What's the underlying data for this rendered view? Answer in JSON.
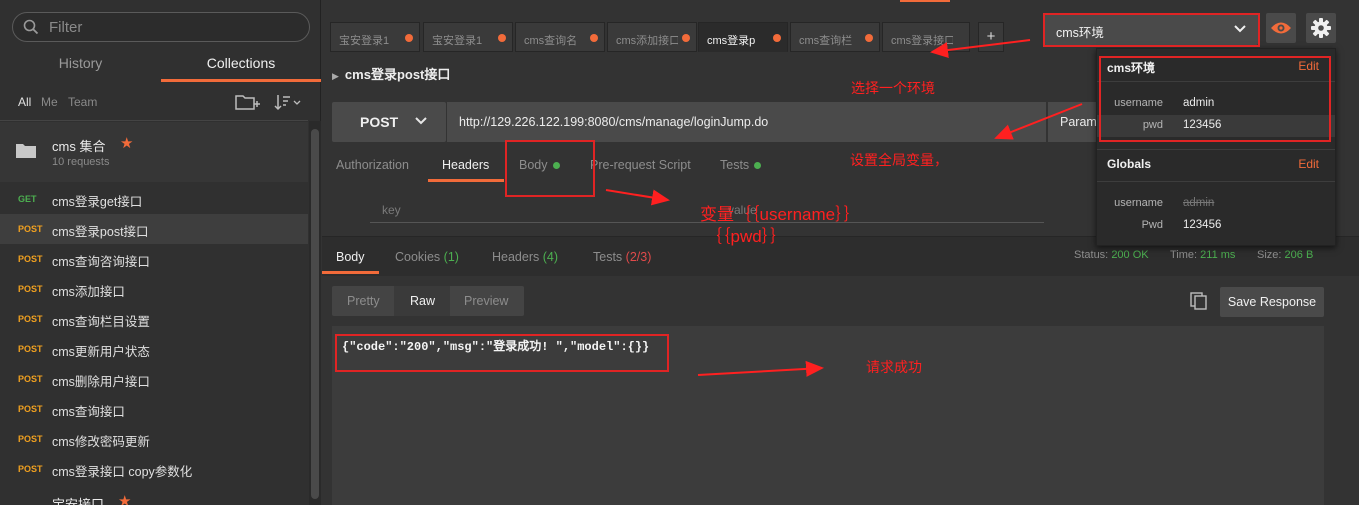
{
  "sidebar": {
    "filter_placeholder": "Filter",
    "tabs": {
      "history": "History",
      "collections": "Collections"
    },
    "filters": {
      "all": "All",
      "me": "Me",
      "team": "Team"
    },
    "collection": {
      "name": "cms 集合",
      "count": "10 requests"
    },
    "requests": [
      {
        "method": "GET",
        "name": "cms登录get接口"
      },
      {
        "method": "POST",
        "name": "cms登录post接口"
      },
      {
        "method": "POST",
        "name": "cms查询咨询接口"
      },
      {
        "method": "POST",
        "name": "cms添加接口"
      },
      {
        "method": "POST",
        "name": "cms查询栏目设置"
      },
      {
        "method": "POST",
        "name": "cms更新用户状态"
      },
      {
        "method": "POST",
        "name": "cms删除用户接口"
      },
      {
        "method": "POST",
        "name": "cms查询接口"
      },
      {
        "method": "POST",
        "name": "cms修改密码更新"
      },
      {
        "method": "POST",
        "name": "cms登录接口 copy参数化"
      }
    ],
    "next_collection": "宝安接口"
  },
  "tabs": [
    {
      "label": "宝安登录1"
    },
    {
      "label": "宝安登录1"
    },
    {
      "label": "cms查询名"
    },
    {
      "label": "cms添加接口"
    },
    {
      "label": "cms登录p"
    },
    {
      "label": "cms查询栏"
    },
    {
      "label": "cms登录接口 co"
    }
  ],
  "add_tab": "+",
  "request": {
    "title": "cms登录post接口",
    "method": "POST",
    "url": "http://129.226.122.199:8080/cms/manage/loginJump.do",
    "params_label": "Param"
  },
  "subtabs": {
    "authorization": "Authorization",
    "headers": "Headers",
    "body": "Body",
    "prerequest": "Pre-request Script",
    "tests": "Tests"
  },
  "headers_editor": {
    "key_placeholder": "key",
    "value_placeholder": "value"
  },
  "response": {
    "tabs": {
      "body": "Body",
      "cookies": "Cookies",
      "cookies_count": "(1)",
      "headers": "Headers",
      "headers_count": "(4)",
      "tests": "Tests",
      "tests_count": "(2/3)"
    },
    "status_label": "Status:",
    "status": "200 OK",
    "time_label": "Time:",
    "time": "211 ms",
    "size_label": "Size:",
    "size": "206 B",
    "formats": {
      "pretty": "Pretty",
      "raw": "Raw",
      "preview": "Preview"
    },
    "save_label": "Save Response",
    "body_text": "{\"code\":\"200\",\"msg\":\"登录成功! \",\"model\":{}}"
  },
  "environment": {
    "selected": "cms环境",
    "panel": {
      "env_name": "cms环境",
      "edit": "Edit",
      "vars": [
        {
          "key": "username",
          "value": "admin"
        },
        {
          "key": "pwd",
          "value": "123456"
        }
      ],
      "globals_title": "Globals",
      "globals_edit": "Edit",
      "globals": [
        {
          "key": "username",
          "value": "admin"
        },
        {
          "key": "Pwd",
          "value": "123456"
        }
      ]
    }
  },
  "annotations": {
    "choose_env": "选择一个环境",
    "set_global": "设置全局变量，",
    "variable_line1": "变量｛｛username｝｝",
    "variable_line2": "｛｛pwd｝｝",
    "request_success": "请求成功"
  },
  "colors": {
    "accent": "#f26b3a",
    "success": "#4caf50",
    "annotation": "#ff2020"
  }
}
